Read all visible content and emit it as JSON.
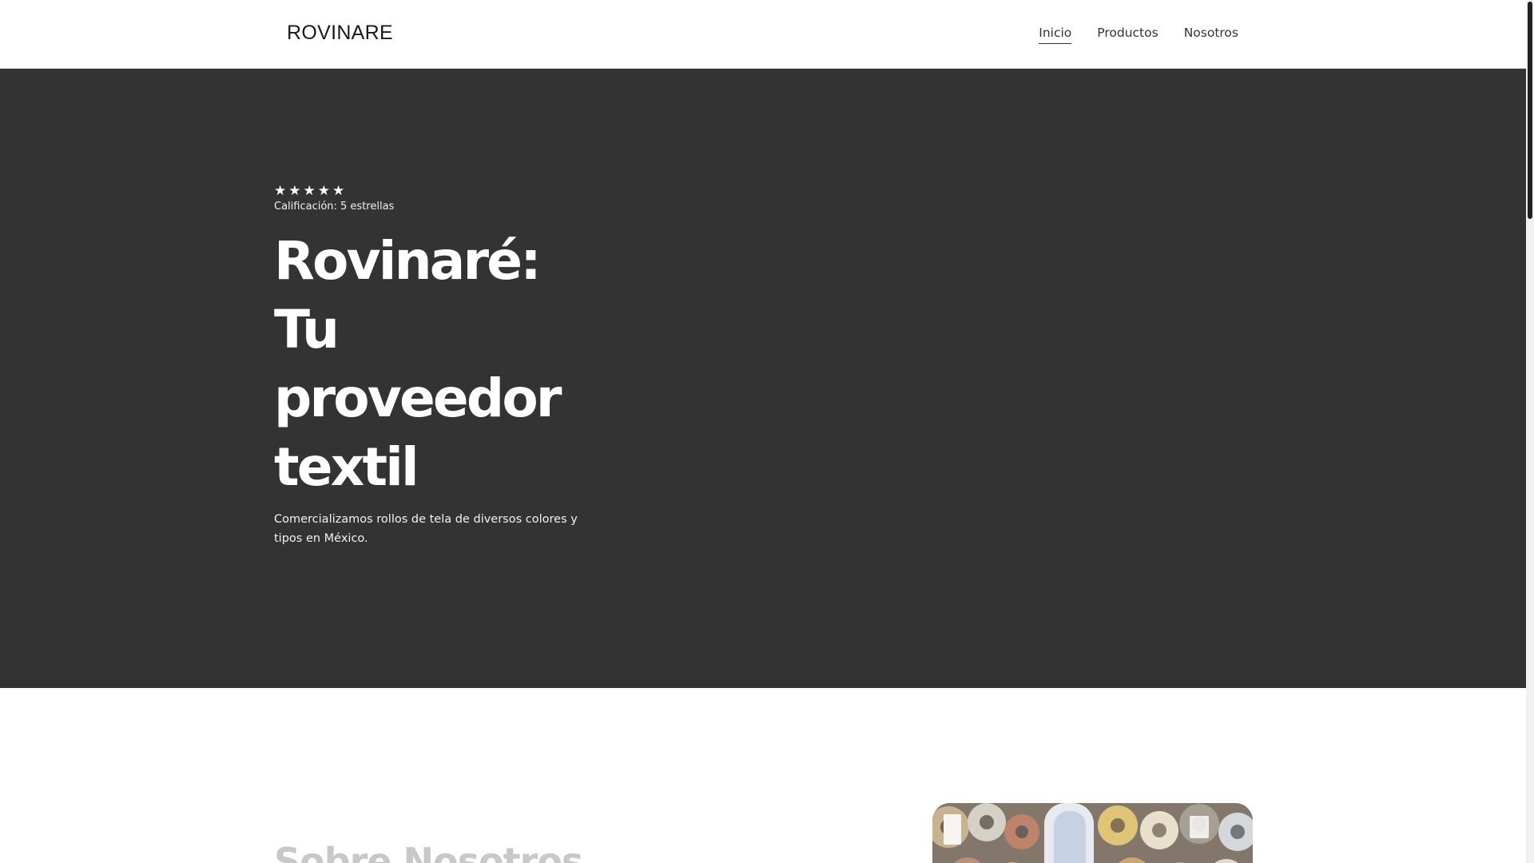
{
  "header": {
    "brand": "ROVINARE",
    "nav": [
      {
        "label": "Inicio",
        "active": true
      },
      {
        "label": "Productos",
        "active": false
      },
      {
        "label": "Nosotros",
        "active": false
      }
    ]
  },
  "hero": {
    "rating": {
      "stars": 5,
      "star_glyph": "★",
      "label": "Calificación: 5 estrellas"
    },
    "title_lines": [
      "Rovinaré: Tu",
      "proveedor",
      "textil"
    ],
    "description": "Comercializamos rollos de tela de diversos colores y tipos en México."
  },
  "about": {
    "title": "Sobre Nosotros",
    "image_icon": "fabric-rolls-photo"
  },
  "colors": {
    "hero_bg": "#333333",
    "text_dark": "#1a1a1a",
    "text_light": "#ffffff",
    "about_title_faded": "#c8c8c8"
  }
}
